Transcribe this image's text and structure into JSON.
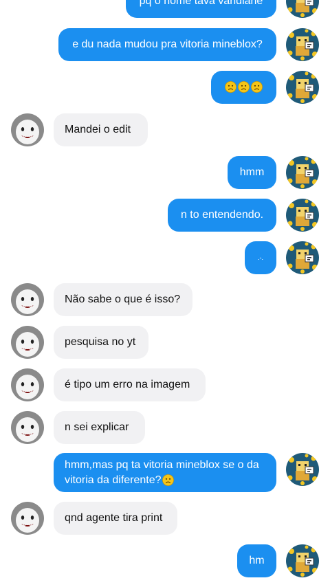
{
  "messages": [
    {
      "side": "out",
      "text": "pq o nome tava varidiane"
    },
    {
      "side": "out",
      "text": "e du nada mudou pra vitoria mineblox?"
    },
    {
      "side": "out",
      "text": "",
      "emoji_count": 3
    },
    {
      "side": "in",
      "text": "Mandei o edit"
    },
    {
      "side": "out",
      "text": "hmm"
    },
    {
      "side": "out",
      "text": "n to entendendo."
    },
    {
      "side": "out",
      "text": ".-."
    },
    {
      "side": "in",
      "text": "Não sabe o que é isso?"
    },
    {
      "side": "in",
      "text": "pesquisa no yt"
    },
    {
      "side": "in",
      "text": "é tipo um erro na imagem"
    },
    {
      "side": "in",
      "text": "n sei explicar"
    },
    {
      "side": "out",
      "text": "hmm,mas pq ta vitoria mineblox se o da vitoria da diferente?",
      "emoji_count": 1
    },
    {
      "side": "in",
      "text": "qnd agente tira print"
    },
    {
      "side": "out",
      "text": "hm"
    }
  ],
  "colors": {
    "outgoing_bubble": "#1b8ff0",
    "incoming_bubble": "#f1f1f3",
    "emoji": "#f5c518"
  },
  "icons": {
    "emoji": "slightly-frowning-face-icon",
    "my_avatar": "blocky-game-character-avatar",
    "their_avatar": "gray-ghost-face-avatar"
  }
}
